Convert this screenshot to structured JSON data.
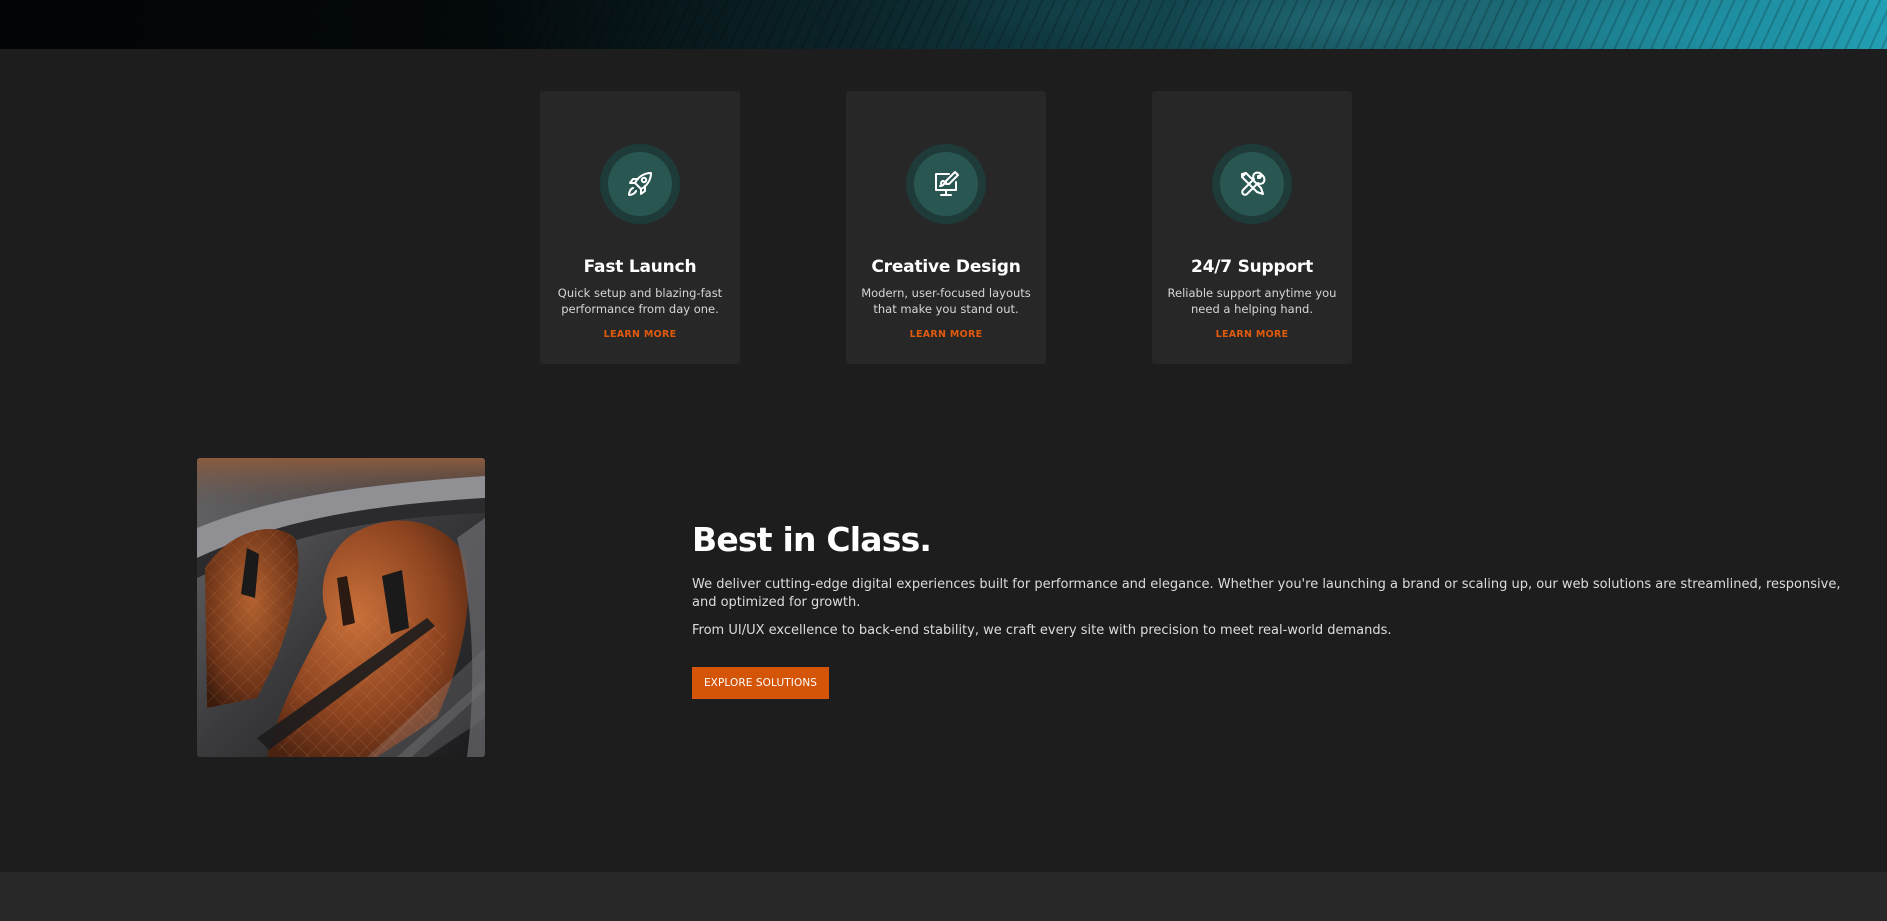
{
  "features": [
    {
      "icon": "rocket-icon",
      "title": "Fast Launch",
      "description": "Quick setup and blazing-fast performance from day one.",
      "link": "LEARN MORE"
    },
    {
      "icon": "design-monitor-icon",
      "title": "Creative Design",
      "description": "Modern, user-focused layouts that make you stand out.",
      "link": "LEARN MORE"
    },
    {
      "icon": "tools-icon",
      "title": "24/7 Support",
      "description": "Reliable support anytime you need a helping hand.",
      "link": "LEARN MORE"
    }
  ],
  "about": {
    "title": "Best in Class.",
    "paragraph1": "We deliver cutting-edge digital experiences built for performance and elegance. Whether you're launching a brand or scaling up, our web solutions are streamlined, responsive, and optimized for growth.",
    "paragraph2": "From UI/UX excellence to back-end stability, we craft every site with precision to meet real-world demands.",
    "cta_label": "EXPLORE SOLUTIONS"
  },
  "colors": {
    "background": "#1d1d1d",
    "card": "#272727",
    "accent": "#d45508",
    "icon_ring": "#1e3b3a",
    "icon_circle": "#2a5652"
  }
}
